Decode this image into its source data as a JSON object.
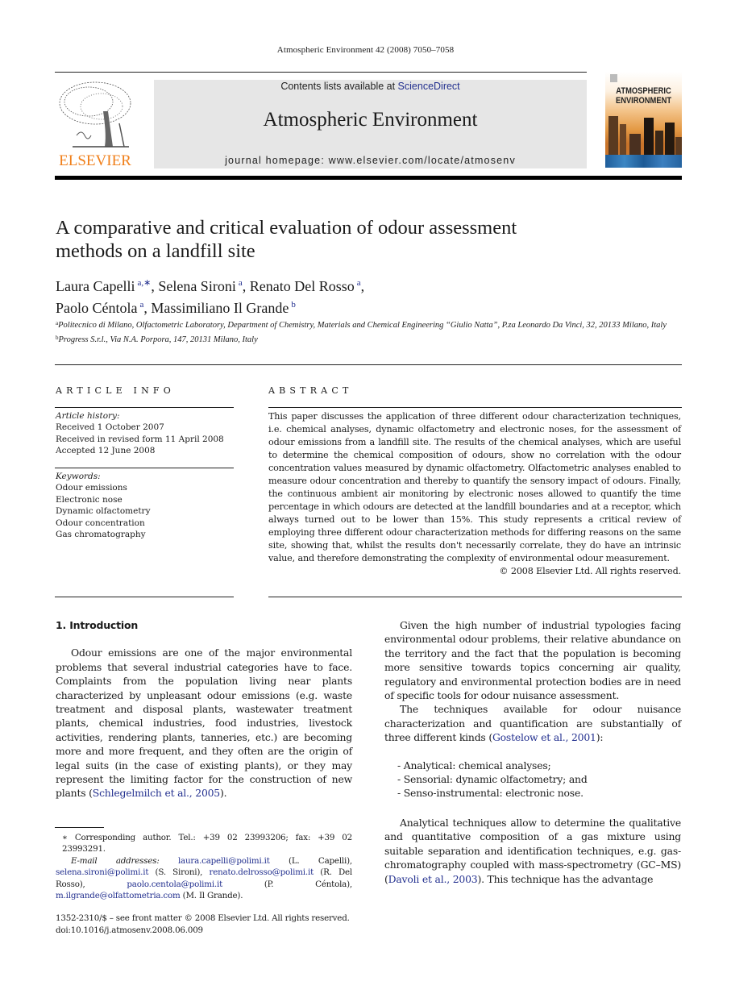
{
  "header": {
    "citation": "Atmospheric Environment 42 (2008) 7050–7058",
    "contents_prefix": "Contents lists available at ",
    "contents_link": "ScienceDirect",
    "journal_title": "Atmospheric Environment",
    "homepage": "journal homepage: www.elsevier.com/locate/atmosenv",
    "publisher_logo_text": "ELSEVIER",
    "cover_title_line1": "ATMOSPHERIC",
    "cover_title_line2": "ENVIRONMENT"
  },
  "colors": {
    "link": "#23308f",
    "elsevier_orange": "#f07f1a",
    "banner_bg": "#e6e6e6"
  },
  "article": {
    "title_line1": "A comparative and critical evaluation of odour assessment",
    "title_line2": "methods on a landfill site",
    "authors": [
      {
        "name": "Laura Capelli",
        "aff": "a,∗",
        "sep": ", "
      },
      {
        "name": "Selena Sironi",
        "aff": "a",
        "sep": ", "
      },
      {
        "name": "Renato Del Rosso",
        "aff": "a",
        "sep": ","
      },
      {
        "name": "Paolo Céntola",
        "aff": "a",
        "sep": ", "
      },
      {
        "name": "Massimiliano Il Grande",
        "aff": "b",
        "sep": ""
      }
    ],
    "affiliations": [
      {
        "mark": "a",
        "text": "Politecnico di Milano, Olfactometric Laboratory, Department of Chemistry, Materials and Chemical Engineering “Giulio Natta”, P.za Leonardo Da Vinci, 32, 20133 Milano, Italy"
      },
      {
        "mark": "b",
        "text": "Progress S.r.l., Via N.A. Porpora, 147, 20131 Milano, Italy"
      }
    ]
  },
  "article_info": {
    "heading": "ARTICLE INFO",
    "history_label": "Article history:",
    "history": [
      "Received 1 October 2007",
      "Received in revised form 11 April 2008",
      "Accepted 12 June 2008"
    ],
    "keywords_label": "Keywords:",
    "keywords": [
      "Odour emissions",
      "Electronic nose",
      "Dynamic olfactometry",
      "Odour concentration",
      "Gas chromatography"
    ]
  },
  "abstract": {
    "heading": "ABSTRACT",
    "text": "This paper discusses the application of three different odour characterization techniques, i.e. chemical analyses, dynamic olfactometry and electronic noses, for the assessment of odour emissions from a landfill site. The results of the chemical analyses, which are useful to determine the chemical composition of odours, show no correlation with the odour concentration values measured by dynamic olfactometry. Olfactometric analyses enabled to measure odour concentration and thereby to quantify the sensory impact of odours. Finally, the continuous ambient air monitoring by electronic noses allowed to quantify the time percentage in which odours are detected at the landfill boundaries and at a receptor, which always turned out to be lower than 15%. This study represents a critical review of employing three different odour characterization methods for differing reasons on the same site, showing that, whilst the results don't necessarily correlate, they do have an intrinsic value, and therefore demonstrating the complexity of environmental odour measurement.",
    "copyright": "© 2008 Elsevier Ltd. All rights reserved."
  },
  "intro": {
    "heading": "1.  Introduction",
    "p1_text": "Odour emissions are one of the major environmental problems that several industrial categories have to face. Complaints from the population living near plants characterized by unpleasant odour emissions (e.g. waste treatment and disposal plants, wastewater treatment plants, chemical industries, food industries, livestock activities, rendering plants, tanneries, etc.) are becoming more and more frequent, and they often are the origin of legal suits (in the case of existing plants), or they may represent the limiting factor for the construction of new plants (",
    "p1_ref": "Schlegelmilch et al., 2005",
    "p1_end": ").",
    "p2_text": "Given the high number of industrial typologies facing environmental odour problems, their relative abundance on the territory and the fact that the population is becoming more sensitive towards topics concerning air quality, regulatory and environmental protection bodies are in need of specific tools for odour nuisance assessment.",
    "p3_text": "The techniques available for odour nuisance characterization and quantification are substantially of three different kinds (",
    "p3_ref": "Gostelow et al., 2001",
    "p3_end": "):",
    "list": [
      "- Analytical: chemical analyses;",
      "- Sensorial: dynamic olfactometry; and",
      "- Senso-instrumental: electronic nose."
    ],
    "p4_text": "Analytical techniques allow to determine the qualitative and quantitative composition of a gas mixture using suitable separation and identification techniques, e.g. gas-chromatography coupled with mass-spectrometry (GC–MS) (",
    "p4_ref": "Davoli et al., 2003",
    "p4_end": "). This technique has the advantage"
  },
  "footnotes": {
    "corresponding": "∗  Corresponding author. Tel.: +39 02 23993206; fax: +39 02 23993291.",
    "email_label": "E-mail addresses:",
    "emails": [
      {
        "addr": "laura.capelli@polimi.it",
        "who": " (L. Capelli), "
      },
      {
        "addr": "selena.sironi@polimi.it",
        "who": " (S. Sironi), "
      },
      {
        "addr": "renato.delrosso@polimi.it",
        "who": " (R. Del Rosso), "
      },
      {
        "addr": "paolo.centola@polimi.it",
        "who": " (P. Céntola), "
      },
      {
        "addr": "m.ilgrande@olfattometria.com",
        "who": " (M. Il Grande)."
      }
    ],
    "issn": "1352-2310/$ – see front matter © 2008 Elsevier Ltd. All rights reserved.",
    "doi": "doi:10.1016/j.atmosenv.2008.06.009"
  }
}
